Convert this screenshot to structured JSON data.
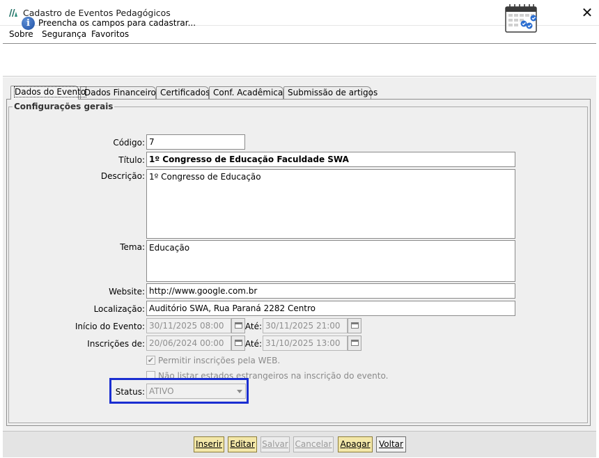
{
  "window": {
    "title": "Cadastro de Eventos Pedagógicos"
  },
  "menu": {
    "items": [
      "Sobre",
      "Segurança",
      "Favoritos"
    ]
  },
  "info": {
    "message": "Preencha os campos para cadastrar..."
  },
  "tabs": [
    "Dados do Evento",
    "Dados Financeiros",
    "Certificados",
    "Conf. Acadêmicas",
    "Submissão de artigos"
  ],
  "group": {
    "title": "Configurações gerais"
  },
  "form": {
    "codigo_label": "Código:",
    "codigo_value": "7",
    "titulo_label": "Título:",
    "titulo_value": "1º Congresso de Educação Faculdade SWA",
    "descricao_label": "Descrição:",
    "descricao_value": "1º Congresso de Educação",
    "tema_label": "Tema:",
    "tema_value": "Educação",
    "website_label": "Website:",
    "website_value": "http://www.google.com.br",
    "localizacao_label": "Localização:",
    "localizacao_value": "Auditório SWA, Rua Paraná 2282 Centro",
    "inicio_label": "Início do Evento:",
    "inicio_value": "30/11/2025 08:00",
    "inicio_ate_label": "Até:",
    "inicio_ate_value": "30/11/2025 21:00",
    "inscricoes_label": "Inscrições de:",
    "inscricoes_value": "20/06/2024 00:00",
    "inscricoes_ate_label": "Até:",
    "inscricoes_ate_value": "31/10/2025 13:00",
    "check_web_label": "Permitir inscrições pela WEB.",
    "check_web_checked": true,
    "check_estrangeiros_label": "Não listar estados estrangeiros na inscrição do evento.",
    "check_estrangeiros_checked": false,
    "status_label": "Status:",
    "status_value": "ATIVO"
  },
  "buttons": {
    "inserir": "Inserir",
    "editar": "Editar",
    "salvar": "Salvar",
    "cancelar": "Cancelar",
    "apagar": "Apagar",
    "voltar": "Voltar"
  },
  "colors": {
    "highlight": "#1a2ed1",
    "accent_button": "#f3e7a8"
  }
}
